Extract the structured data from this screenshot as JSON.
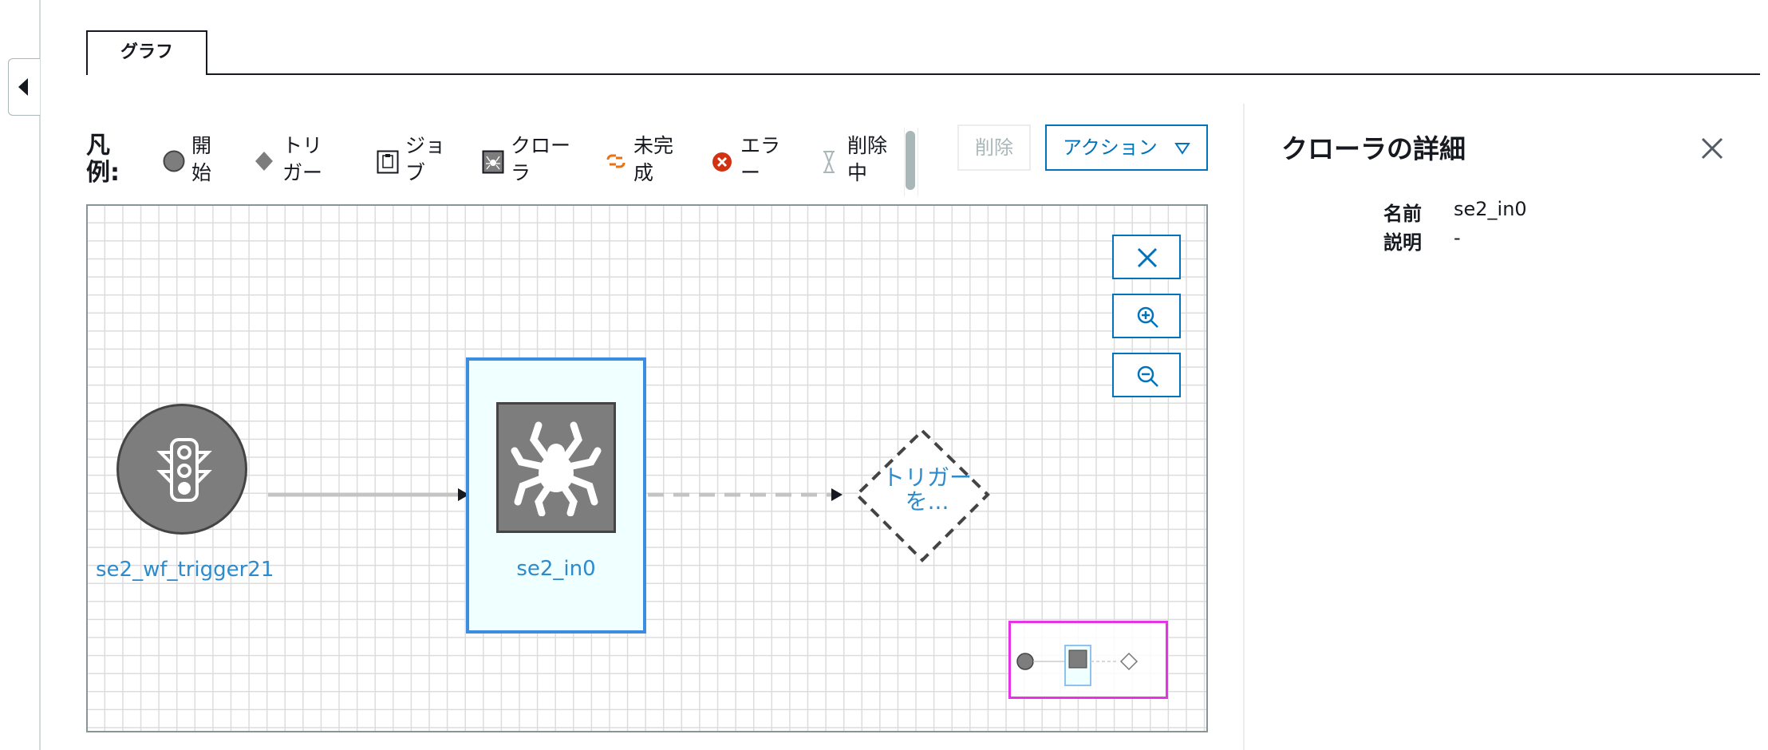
{
  "tabs": [
    {
      "label": "グラフ"
    }
  ],
  "legend": {
    "title": "凡例:",
    "items": [
      {
        "label": "開始",
        "icon": "start-circle-icon"
      },
      {
        "label": "トリガー",
        "icon": "trigger-diamond-icon"
      },
      {
        "label": "ジョブ",
        "icon": "job-clipboard-icon"
      },
      {
        "label": "クローラ",
        "icon": "crawler-spider-icon"
      },
      {
        "label": "未完成",
        "icon": "incomplete-link-icon"
      },
      {
        "label": "エラー",
        "icon": "error-icon"
      },
      {
        "label": "削除中",
        "icon": "hourglass-icon"
      }
    ]
  },
  "toolbar": {
    "delete_label": "削除",
    "action_label": "アクション"
  },
  "graph": {
    "start_node": {
      "label": "se2_wf_trigger21",
      "icon": "traffic-light-icon"
    },
    "crawler_node": {
      "label": "se2_in0",
      "icon": "spider-icon",
      "selected": true
    },
    "trigger_placeholder": {
      "label": "トリガーを..."
    }
  },
  "details": {
    "title": "クローラの詳細",
    "fields": [
      {
        "key": "名前",
        "value": "se2_in0"
      },
      {
        "key": "説明",
        "value": "-"
      }
    ]
  },
  "colors": {
    "accent": "#0073bb",
    "node_blue": "#3b8de1",
    "link_text": "#2d8bcd",
    "minimap_border": "#e633e6",
    "error": "#d13212",
    "incomplete": "#ec7211"
  }
}
